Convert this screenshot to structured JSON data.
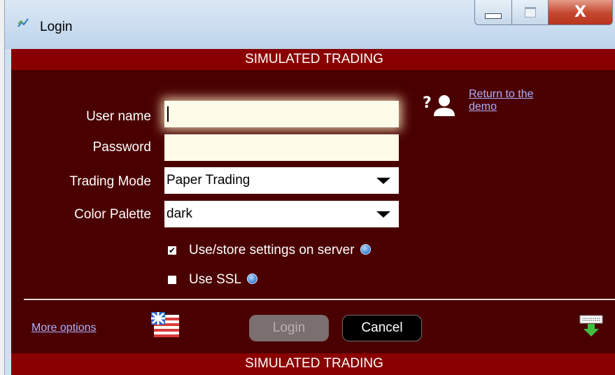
{
  "window": {
    "title": "Login",
    "icon": "app-icon",
    "controls": {
      "minimize": "minimize-icon",
      "maximize": "maximize-icon",
      "close": "X"
    }
  },
  "banner": {
    "top": "SIMULATED TRADING",
    "bottom": "SIMULATED TRADING"
  },
  "form": {
    "username": {
      "label": "User name",
      "value": "",
      "placeholder": ""
    },
    "password": {
      "label": "Password",
      "value": ""
    },
    "trading_mode": {
      "label": "Trading Mode",
      "value": "Paper Trading"
    },
    "color_palette": {
      "label": "Color Palette",
      "value": "dark"
    }
  },
  "options": {
    "store_settings": {
      "label": "Use/store settings on server",
      "checked": true
    },
    "use_ssl": {
      "label": "Use SSL",
      "checked": false
    }
  },
  "links": {
    "return_demo_line1": "Return to the",
    "return_demo_line2": "demo",
    "more_options": "More options"
  },
  "buttons": {
    "login": "Login",
    "cancel": "Cancel"
  },
  "colors": {
    "content_bg": "#4a0000",
    "banner_bg": "#8a0000",
    "link": "#aab2ff",
    "field_bg": "#fffbe9"
  },
  "icons": [
    "user-help-icon",
    "flag-icon",
    "keyboard-download-icon",
    "help-icon"
  ]
}
